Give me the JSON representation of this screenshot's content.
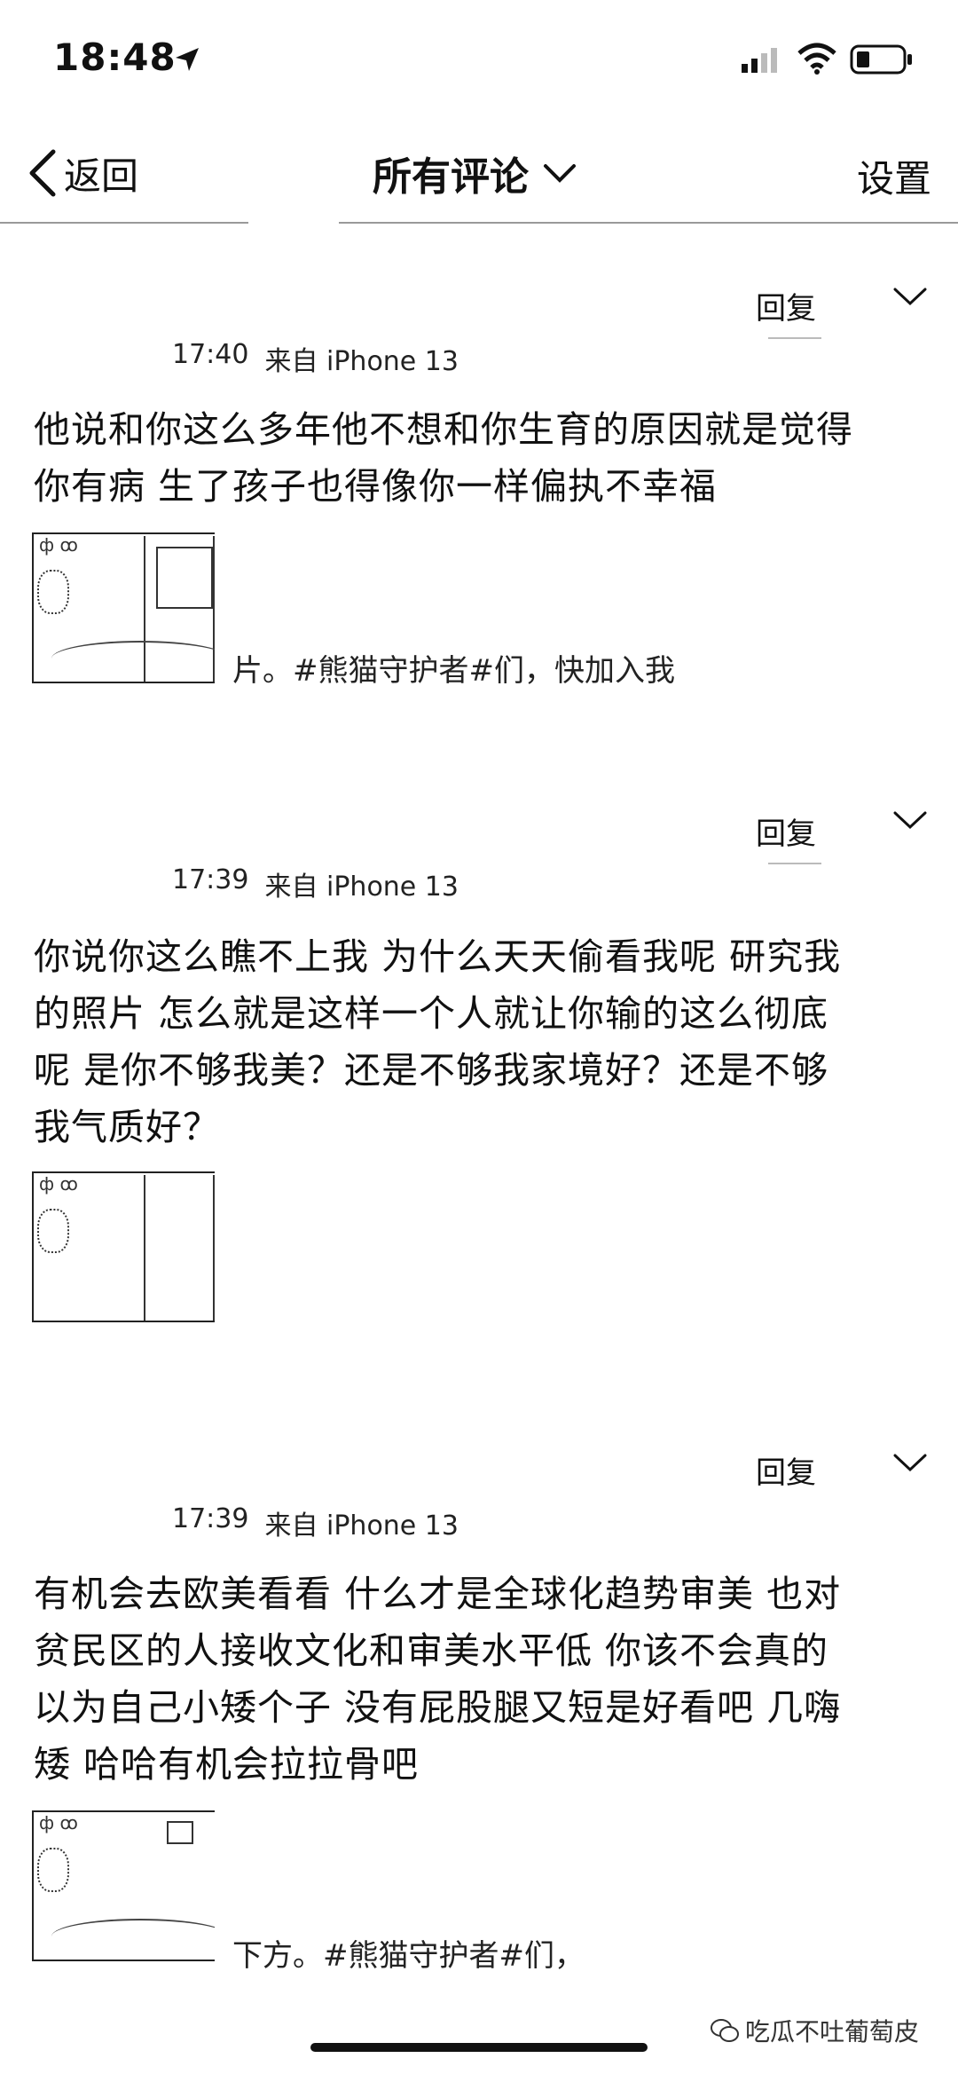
{
  "status_bar": {
    "time": "18:48",
    "icons": [
      "location-arrow-icon",
      "cellular-signal-icon",
      "wifi-icon",
      "battery-icon"
    ]
  },
  "nav": {
    "back_label": "返回",
    "title": "所有评论",
    "settings_label": "设置"
  },
  "comments": [
    {
      "time": "17:40",
      "source": "来自 iPhone 13",
      "reply_label": "回复",
      "text_lines": [
        "他说和你这么多年他不想和你生育的原因就是觉得",
        "你有病 生了孩子也得像你一样偏执不幸福"
      ],
      "share_text": "片。#熊猫守护者#们，快加入我"
    },
    {
      "time": "17:39",
      "source": "来自 iPhone 13",
      "reply_label": "回复",
      "text_lines": [
        "你说你这么瞧不上我 为什么天天偷看我呢 研究我",
        "的照片 怎么就是这样一个人就让你输的这么彻底",
        "呢 是你不够我美？还是不够我家境好？还是不够",
        "我气质好？"
      ],
      "share_text": ""
    },
    {
      "time": "17:39",
      "source": "来自 iPhone 13",
      "reply_label": "回复",
      "text_lines": [
        "有机会去欧美看看 什么才是全球化趋势审美 也对",
        "贫民区的人接收文化和审美水平低 你该不会真的",
        "以为自己小矮个子 没有屁股腿又短是好看吧 几嗨",
        "矮 哈哈有机会拉拉骨吧"
      ],
      "share_text": "下方。#熊猫守护者#们，"
    }
  ],
  "watermark": "吃瓜不吐葡萄皮"
}
